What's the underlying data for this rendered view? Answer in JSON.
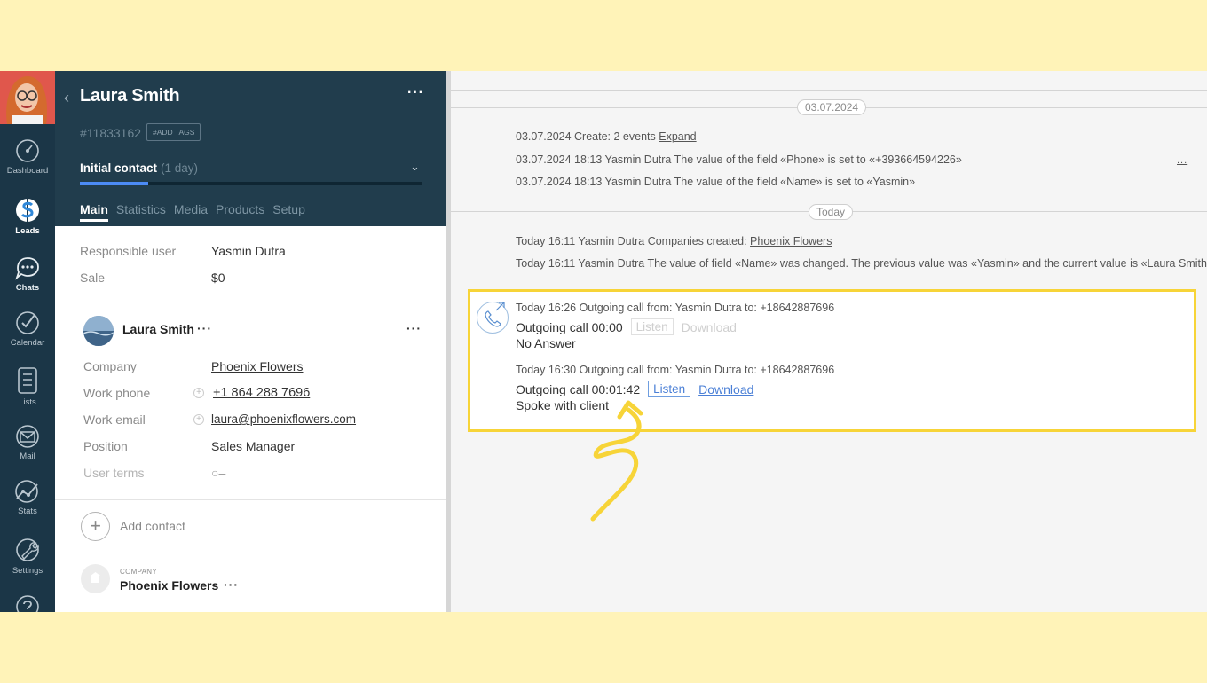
{
  "nav": {
    "items": [
      {
        "label": "Dashboard",
        "icon": "dashboard-icon"
      },
      {
        "label": "Leads",
        "icon": "leads-icon",
        "active": true
      },
      {
        "label": "Chats",
        "icon": "chats-icon"
      },
      {
        "label": "Calendar",
        "icon": "calendar-icon"
      },
      {
        "label": "Lists",
        "icon": "lists-icon"
      },
      {
        "label": "Mail",
        "icon": "mail-icon"
      },
      {
        "label": "Stats",
        "icon": "stats-icon"
      },
      {
        "label": "Settings",
        "icon": "settings-icon"
      }
    ]
  },
  "card": {
    "name": "Laura Smith",
    "more": "···",
    "id": "#11833162",
    "add_tags": "#ADD TAGS",
    "stage": "Initial contact",
    "stage_duration": "(1 day)",
    "pipeline_progress": 0.2,
    "tabs": [
      "Main",
      "Statistics",
      "Media",
      "Products",
      "Setup"
    ],
    "active_tab": "Main",
    "fields": {
      "responsible_user": {
        "label": "Responsible user",
        "value": "Yasmin Dutra"
      },
      "sale": {
        "label": "Sale",
        "value": "$0"
      }
    },
    "contact": {
      "name": "Laura Smith",
      "more": "···",
      "company": {
        "label": "Company",
        "value": "Phoenix Flowers"
      },
      "work_phone": {
        "label": "Work phone",
        "value": "+1 864 288 7696"
      },
      "work_email": {
        "label": "Work email",
        "value": "laura@phoenixflowers.com"
      },
      "position": {
        "label": "Position",
        "value": "Sales Manager"
      },
      "user_terms": {
        "label": "User terms",
        "value": "○–"
      }
    },
    "add_contact": "Add contact",
    "company": {
      "tag": "COMPANY",
      "name": "Phoenix Flowers",
      "more": "···"
    }
  },
  "feed": {
    "date1": "03.07.2024",
    "date2": "Today",
    "more": "...",
    "events1": [
      {
        "text": "03.07.2024 Create: 2 events ",
        "link": "Expand"
      },
      {
        "text": "03.07.2024 18:13 Yasmin Dutra The value of the field «Phone» is set to «+393664594226»"
      },
      {
        "text": "03.07.2024 18:13 Yasmin Dutra The value of the field «Name» is set to «Yasmin»"
      }
    ],
    "events2": [
      {
        "text": "Today 16:11 Yasmin Dutra Companies created: ",
        "link": "Phoenix Flowers"
      },
      {
        "text": "Today 16:11 Yasmin Dutra The value of field «Name» was changed. The previous value was «Yasmin» and the current value is «Laura Smith»"
      }
    ],
    "calls": [
      {
        "meta": "Today 16:26 Outgoing call from: Yasmin Dutra to: +18642887696",
        "title": "Outgoing call 00:00",
        "listen": "Listen",
        "download": "Download",
        "enabled": false,
        "result": "No Answer"
      },
      {
        "meta": "Today 16:30 Outgoing call from: Yasmin Dutra to: +18642887696",
        "title": "Outgoing call 00:01:42",
        "listen": "Listen",
        "download": "Download",
        "enabled": true,
        "result": "Spoke with client"
      }
    ],
    "highlight_color": "#f7d438",
    "link_color": "#4a7fd6"
  }
}
